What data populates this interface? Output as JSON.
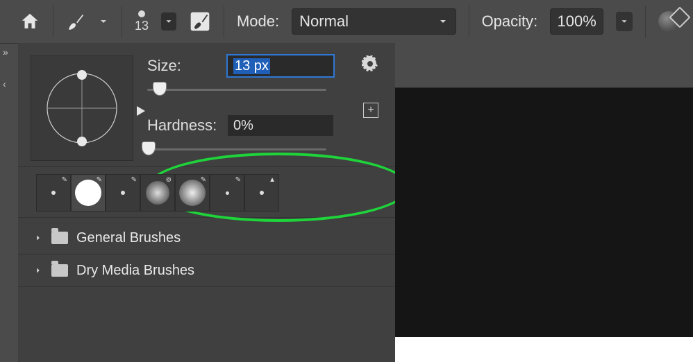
{
  "toolbar": {
    "brush_size_display": "13",
    "mode_label": "Mode:",
    "mode_value": "Normal",
    "opacity_label": "Opacity:",
    "opacity_value": "100%"
  },
  "panel": {
    "size_label": "Size:",
    "size_value": "13 px",
    "hardness_label": "Hardness:",
    "hardness_value": "0%"
  },
  "folders": [
    {
      "label": "General Brushes"
    },
    {
      "label": "Dry Media Brushes"
    }
  ],
  "left_strip": [
    "»",
    "‹",
    "",
    "",
    "",
    "",
    ""
  ]
}
